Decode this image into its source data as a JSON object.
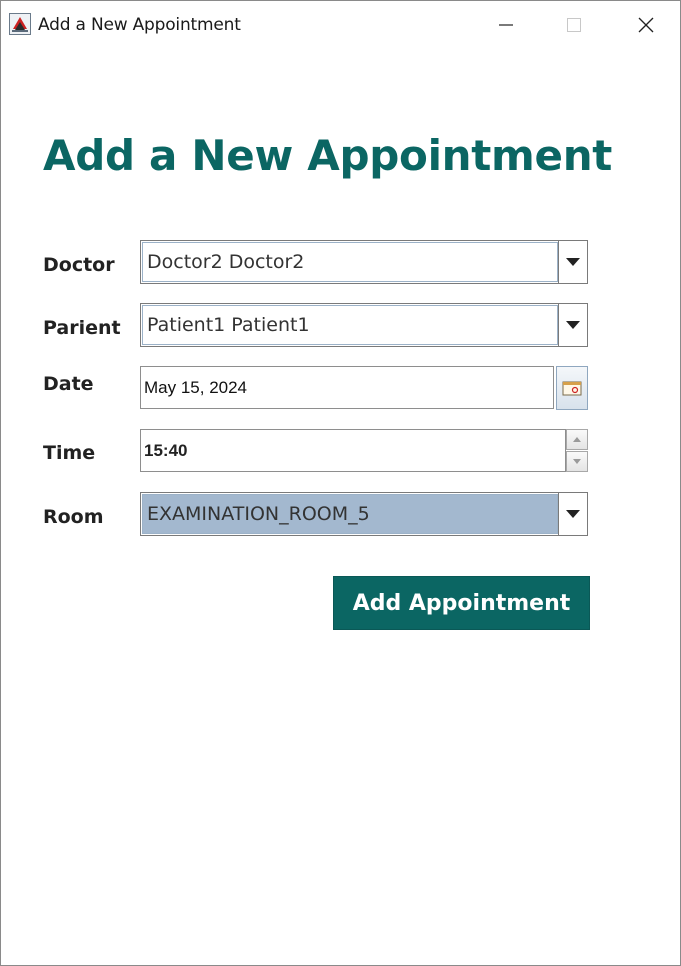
{
  "window": {
    "title": "Add a New Appointment",
    "controls": [
      "minimize-icon",
      "maximize-icon",
      "close-icon"
    ]
  },
  "heading": "Add a New Appointment",
  "form": {
    "doctor": {
      "label": "Doctor",
      "value": "Doctor2 Doctor2"
    },
    "patient": {
      "label": "Parient",
      "value": "Patient1 Patient1"
    },
    "date": {
      "label": "Date",
      "value": "May 15, 2024",
      "icon": "calendar-icon"
    },
    "time": {
      "label": "Time",
      "value": "15:40"
    },
    "room": {
      "label": "Room",
      "value": "EXAMINATION_ROOM_5"
    }
  },
  "submit_label": "Add Appointment",
  "colors": {
    "accent": "#0b6663",
    "selection": "#a3b8cf"
  }
}
